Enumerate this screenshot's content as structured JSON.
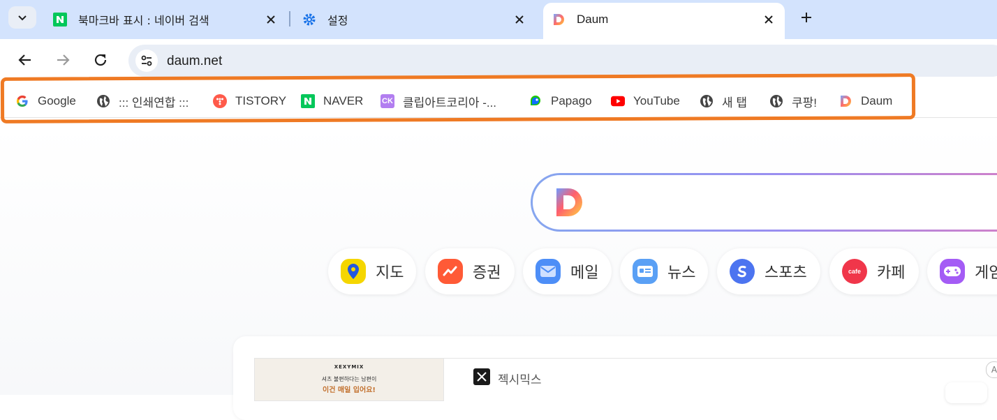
{
  "tabs": [
    {
      "title": "북마크바 표시 : 네이버 검색",
      "favicon": "naver-icon",
      "active": false
    },
    {
      "title": "설정",
      "favicon": "gear-icon",
      "active": false
    },
    {
      "title": "Daum",
      "favicon": "daum-icon",
      "active": true
    }
  ],
  "toolbar": {
    "url": "daum.net"
  },
  "bookmarks": [
    {
      "label": "Google",
      "icon": "google-icon"
    },
    {
      "label": "::: 인쇄연합 :::",
      "icon": "globe-icon"
    },
    {
      "label": "TISTORY",
      "icon": "tistory-icon"
    },
    {
      "label": "NAVER",
      "icon": "naver-icon"
    },
    {
      "label": "클립아트코리아 -...",
      "icon": "clipart-korea-icon",
      "icon_text": "CK"
    },
    {
      "label": "Papago",
      "icon": "papago-icon"
    },
    {
      "label": "YouTube",
      "icon": "youtube-icon"
    },
    {
      "label": "새 탭",
      "icon": "globe-icon"
    },
    {
      "label": "쿠팡!",
      "icon": "globe-icon"
    },
    {
      "label": "Daum",
      "icon": "daum-icon"
    }
  ],
  "services": [
    {
      "label": "지도",
      "icon": "map-pin-icon",
      "color": "#f5d600"
    },
    {
      "label": "증권",
      "icon": "stock-chart-icon",
      "color": "#ff5a36"
    },
    {
      "label": "메일",
      "icon": "mail-icon",
      "color": "#4d8ef7"
    },
    {
      "label": "뉴스",
      "icon": "news-icon",
      "color": "#5aa0f5"
    },
    {
      "label": "스포츠",
      "icon": "sports-icon",
      "color": "#4c74f0"
    },
    {
      "label": "카페",
      "icon": "cafe-icon",
      "color": "#f0364a",
      "icon_text": "cafe"
    },
    {
      "label": "게임",
      "icon": "game-controller-icon",
      "color": "#a45cf5"
    }
  ],
  "ad": {
    "brand": "XEXYMIX",
    "line1": "셔츠 불편하다는 남편이",
    "line2": "이건 매일 입어요!",
    "name": "젝시믹스",
    "badge": "A"
  },
  "colors": {
    "tabstrip": "#d3e3fd",
    "highlight": "#ef7a24"
  }
}
